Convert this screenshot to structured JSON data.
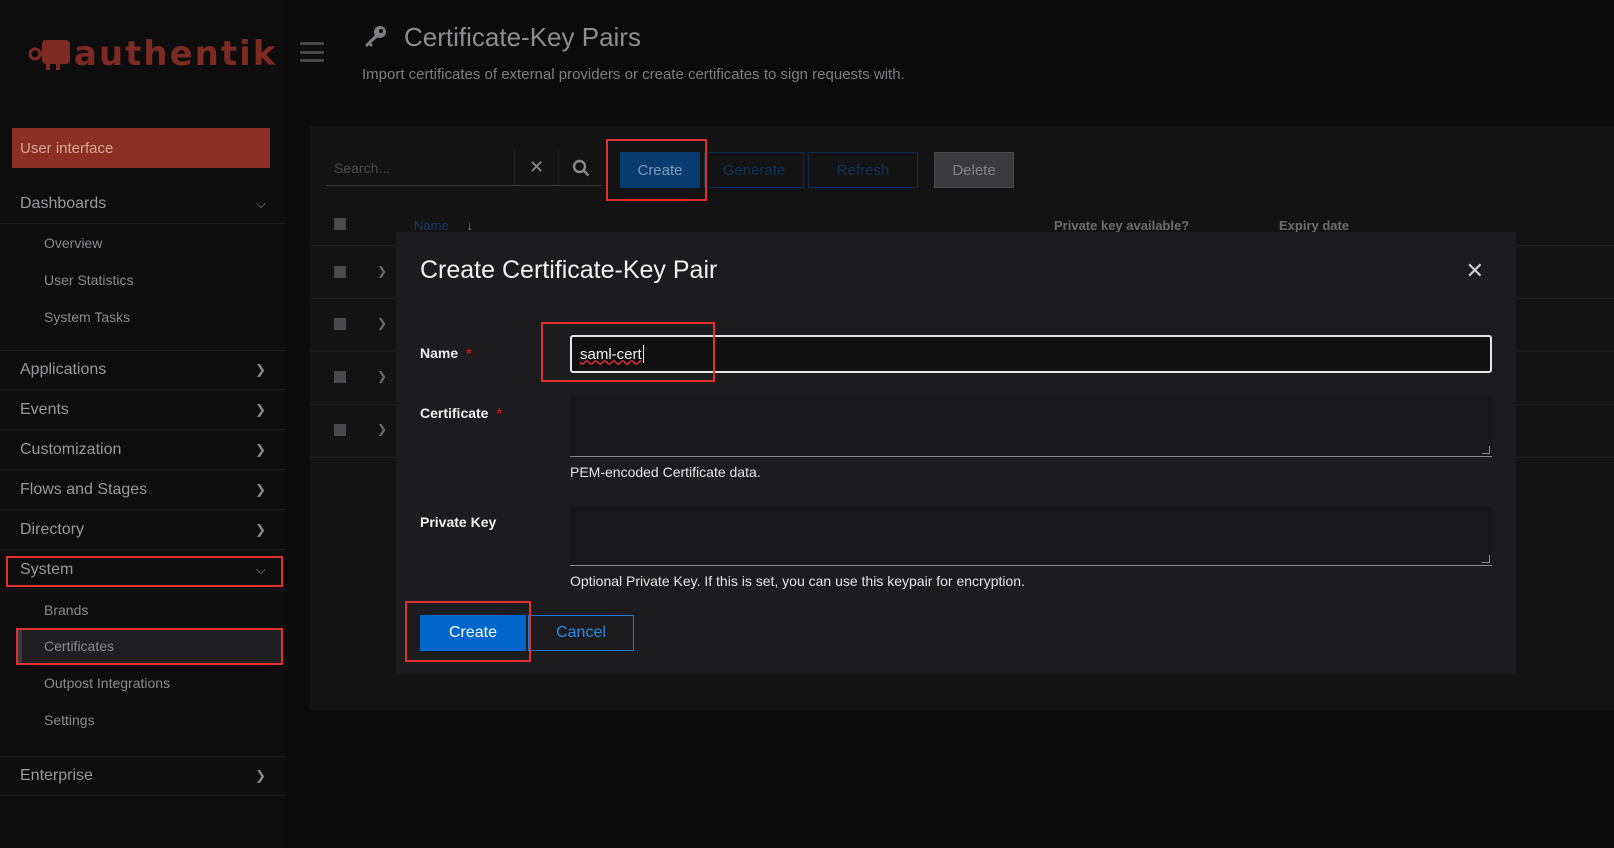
{
  "app": {
    "name": "authentik"
  },
  "sidebar": {
    "user_interface": "User interface",
    "dashboards": {
      "label": "Dashboards",
      "items": [
        "Overview",
        "User Statistics",
        "System Tasks"
      ]
    },
    "applications": "Applications",
    "events": "Events",
    "customization": "Customization",
    "flows": "Flows and Stages",
    "directory": "Directory",
    "system": {
      "label": "System",
      "items": [
        "Brands",
        "Certificates",
        "Outpost Integrations",
        "Settings"
      ]
    },
    "enterprise": "Enterprise"
  },
  "header": {
    "title": "Certificate-Key Pairs",
    "description": "Import certificates of external providers or create certificates to sign requests with."
  },
  "toolbar": {
    "search_placeholder": "Search...",
    "create": "Create",
    "generate": "Generate",
    "refresh": "Refresh",
    "delete": "Delete"
  },
  "table": {
    "columns": [
      "Name",
      "Private key available?",
      "Expiry date"
    ]
  },
  "modal": {
    "title": "Create Certificate-Key Pair",
    "fields": {
      "name": {
        "label": "Name",
        "value": "saml-cert"
      },
      "certificate": {
        "label": "Certificate",
        "helper": "PEM-encoded Certificate data."
      },
      "private_key": {
        "label": "Private Key",
        "helper": "Optional Private Key. If this is set, you can use this keypair for encryption."
      }
    },
    "create": "Create",
    "cancel": "Cancel"
  },
  "colors": {
    "brand": "#fd4b2d",
    "primary": "#0066cc",
    "highlight": "#e0312f"
  }
}
